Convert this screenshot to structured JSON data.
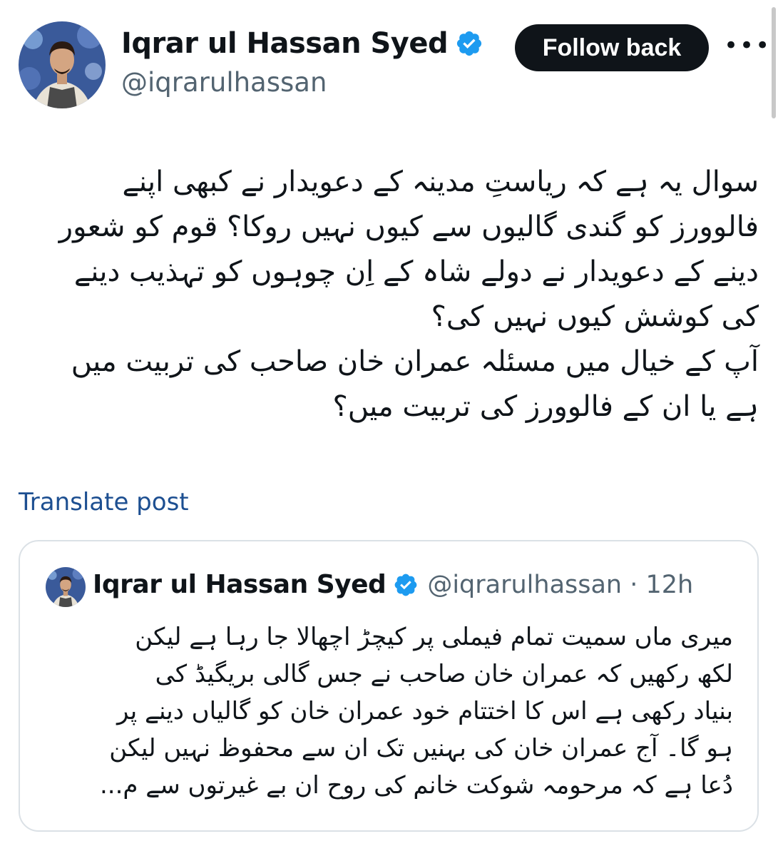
{
  "author": {
    "display_name": "Iqrar ul Hassan Syed",
    "handle": "@iqrarulhassan",
    "verified_icon": "verified-badge-icon"
  },
  "actions": {
    "follow_label": "Follow back",
    "more_label": "•••"
  },
  "post": {
    "lines": [
      "سوال یہ ہے کہ ریاستِ مدینہ کے دعویدار نے کبھی اپنے",
      "فالوورز کو گندی گالیوں سے کیوں نہیں روکا؟ قوم کو شعور",
      "دینے کے دعویدار نے دولے شاہ کے اِن چوہوں کو تہذیب دینے",
      "کی کوشش کیوں نہیں کی؟",
      "آپ کے خیال میں مسئلہ عمران خان صاحب کی تربیت میں",
      "ہے یا ان کے فالوورز کی تربیت میں؟"
    ],
    "translate_label": "Translate post"
  },
  "quote": {
    "display_name": "Iqrar ul Hassan Syed",
    "handle_time": "@iqrarulhassan · 12h",
    "lines": [
      "میری ماں سمیت تمام فیملی پر کیچڑ اچھالا جا رہا ہے لیکن",
      "لکھ رکھیں کہ عمران خان صاحب نے جس گالی بریگیڈ کی",
      "بنیاد رکھی ہے اس کا اختتام خود عمران خان کو گالیاں دینے پر",
      "ہو گا۔ آج عمران خان کی بہنیں تک ان سے محفوظ نہیں لیکن",
      "دُعا ہے کہ مرحومہ شوکت خانم کی روح ان بے غیرتوں سے م..."
    ]
  },
  "colors": {
    "text": "#0f1419",
    "secondary": "#536471",
    "verified": "#1d9bf0",
    "link": "#1d4f91",
    "border": "#dbe1e6"
  }
}
